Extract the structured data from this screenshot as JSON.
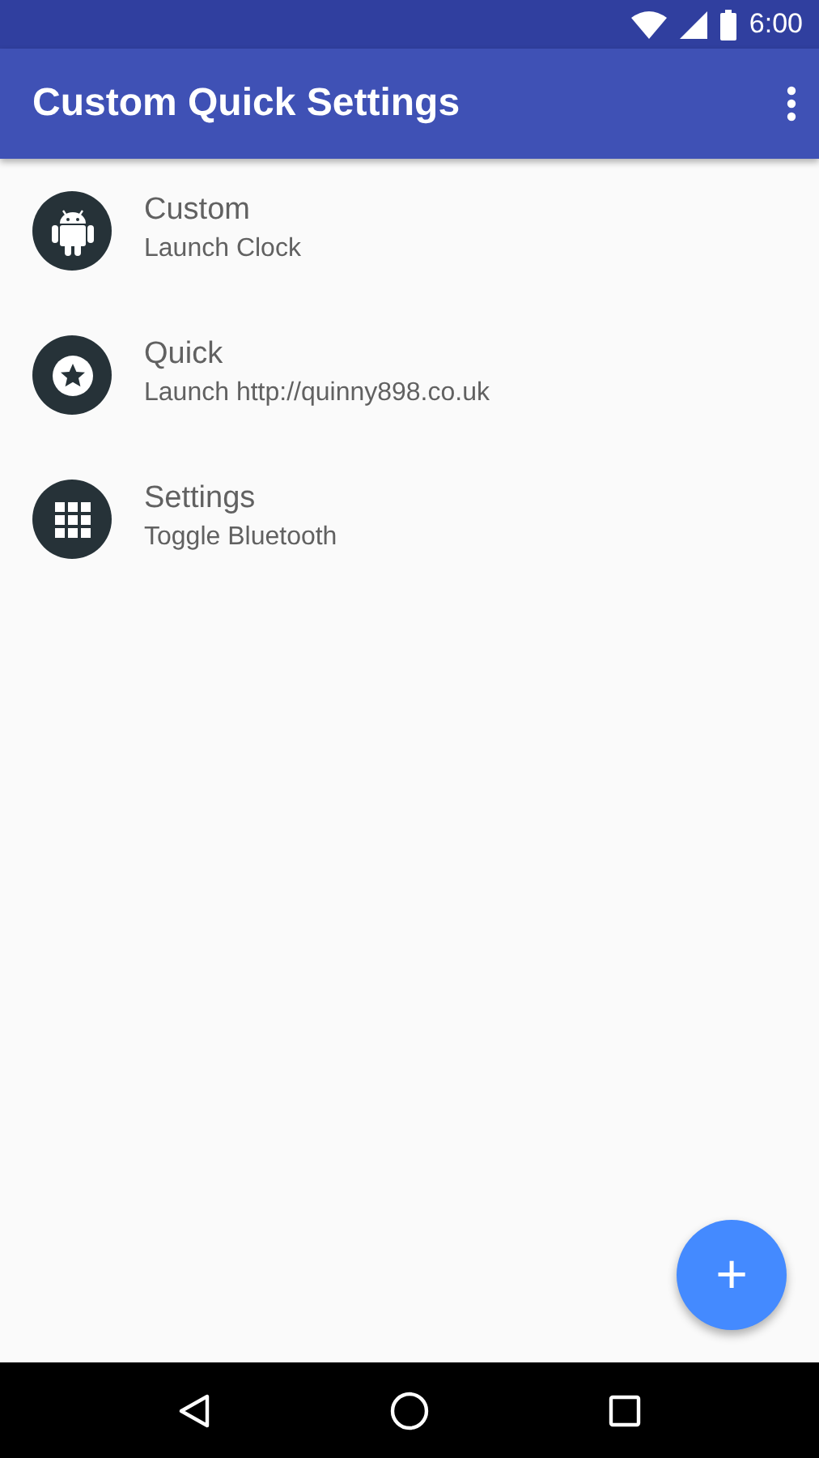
{
  "status_bar": {
    "time": "6:00"
  },
  "app_bar": {
    "title": "Custom Quick Settings"
  },
  "items": [
    {
      "title": "Custom",
      "subtitle": "Launch Clock"
    },
    {
      "title": "Quick",
      "subtitle": "Launch http://quinny898.co.uk"
    },
    {
      "title": "Settings",
      "subtitle": "Toggle Bluetooth"
    }
  ],
  "fab": {
    "label": "+"
  }
}
